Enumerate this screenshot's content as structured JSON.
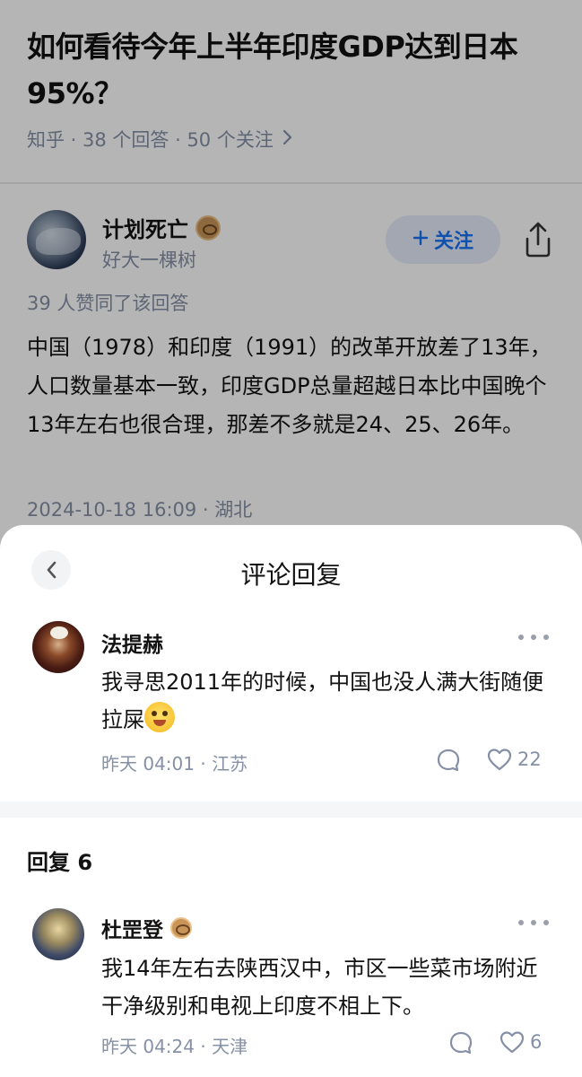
{
  "question": {
    "title": "如何看待今年上半年印度GDP达到日本95%？",
    "meta": "知乎 · 38 个回答 · 50 个关注"
  },
  "answer": {
    "author_name": "计划死亡",
    "author_subtitle": "好大一棵树",
    "follow_label": "关注",
    "agree_text": "39 人赞同了该回答",
    "content": "中国（1978）和印度（1991）的改革开放差了13年，人口数量基本一致，印度GDP总量超越日本比中国晚个13年左右也很合理，那差不多就是24、25、26年。",
    "meta": "2024-10-18 16:09 · 湖北"
  },
  "sheet": {
    "title": "评论回复",
    "root_comment": {
      "author": "法提赫",
      "text": "我寻思2011年的时候，中国也没人满大街随便拉屎",
      "meta": "昨天 04:01 · 江苏",
      "likes": "22"
    },
    "reply_count_label": "回复 6",
    "replies": [
      {
        "author": "杜罡登",
        "text": "我14年左右去陕西汉中，市区一些菜市场附近干净级别和电视上印度不相上下。",
        "meta": "昨天 04:24 · 天津",
        "likes": "6"
      }
    ]
  },
  "colors": {
    "accent": "#1772f6",
    "muted": "#8590a6",
    "text": "#121212"
  },
  "icons": [
    "chevron-right-icon",
    "share-icon",
    "back-icon",
    "more-icon",
    "reply-icon",
    "heart-icon",
    "plus-icon",
    "badge-icon"
  ]
}
